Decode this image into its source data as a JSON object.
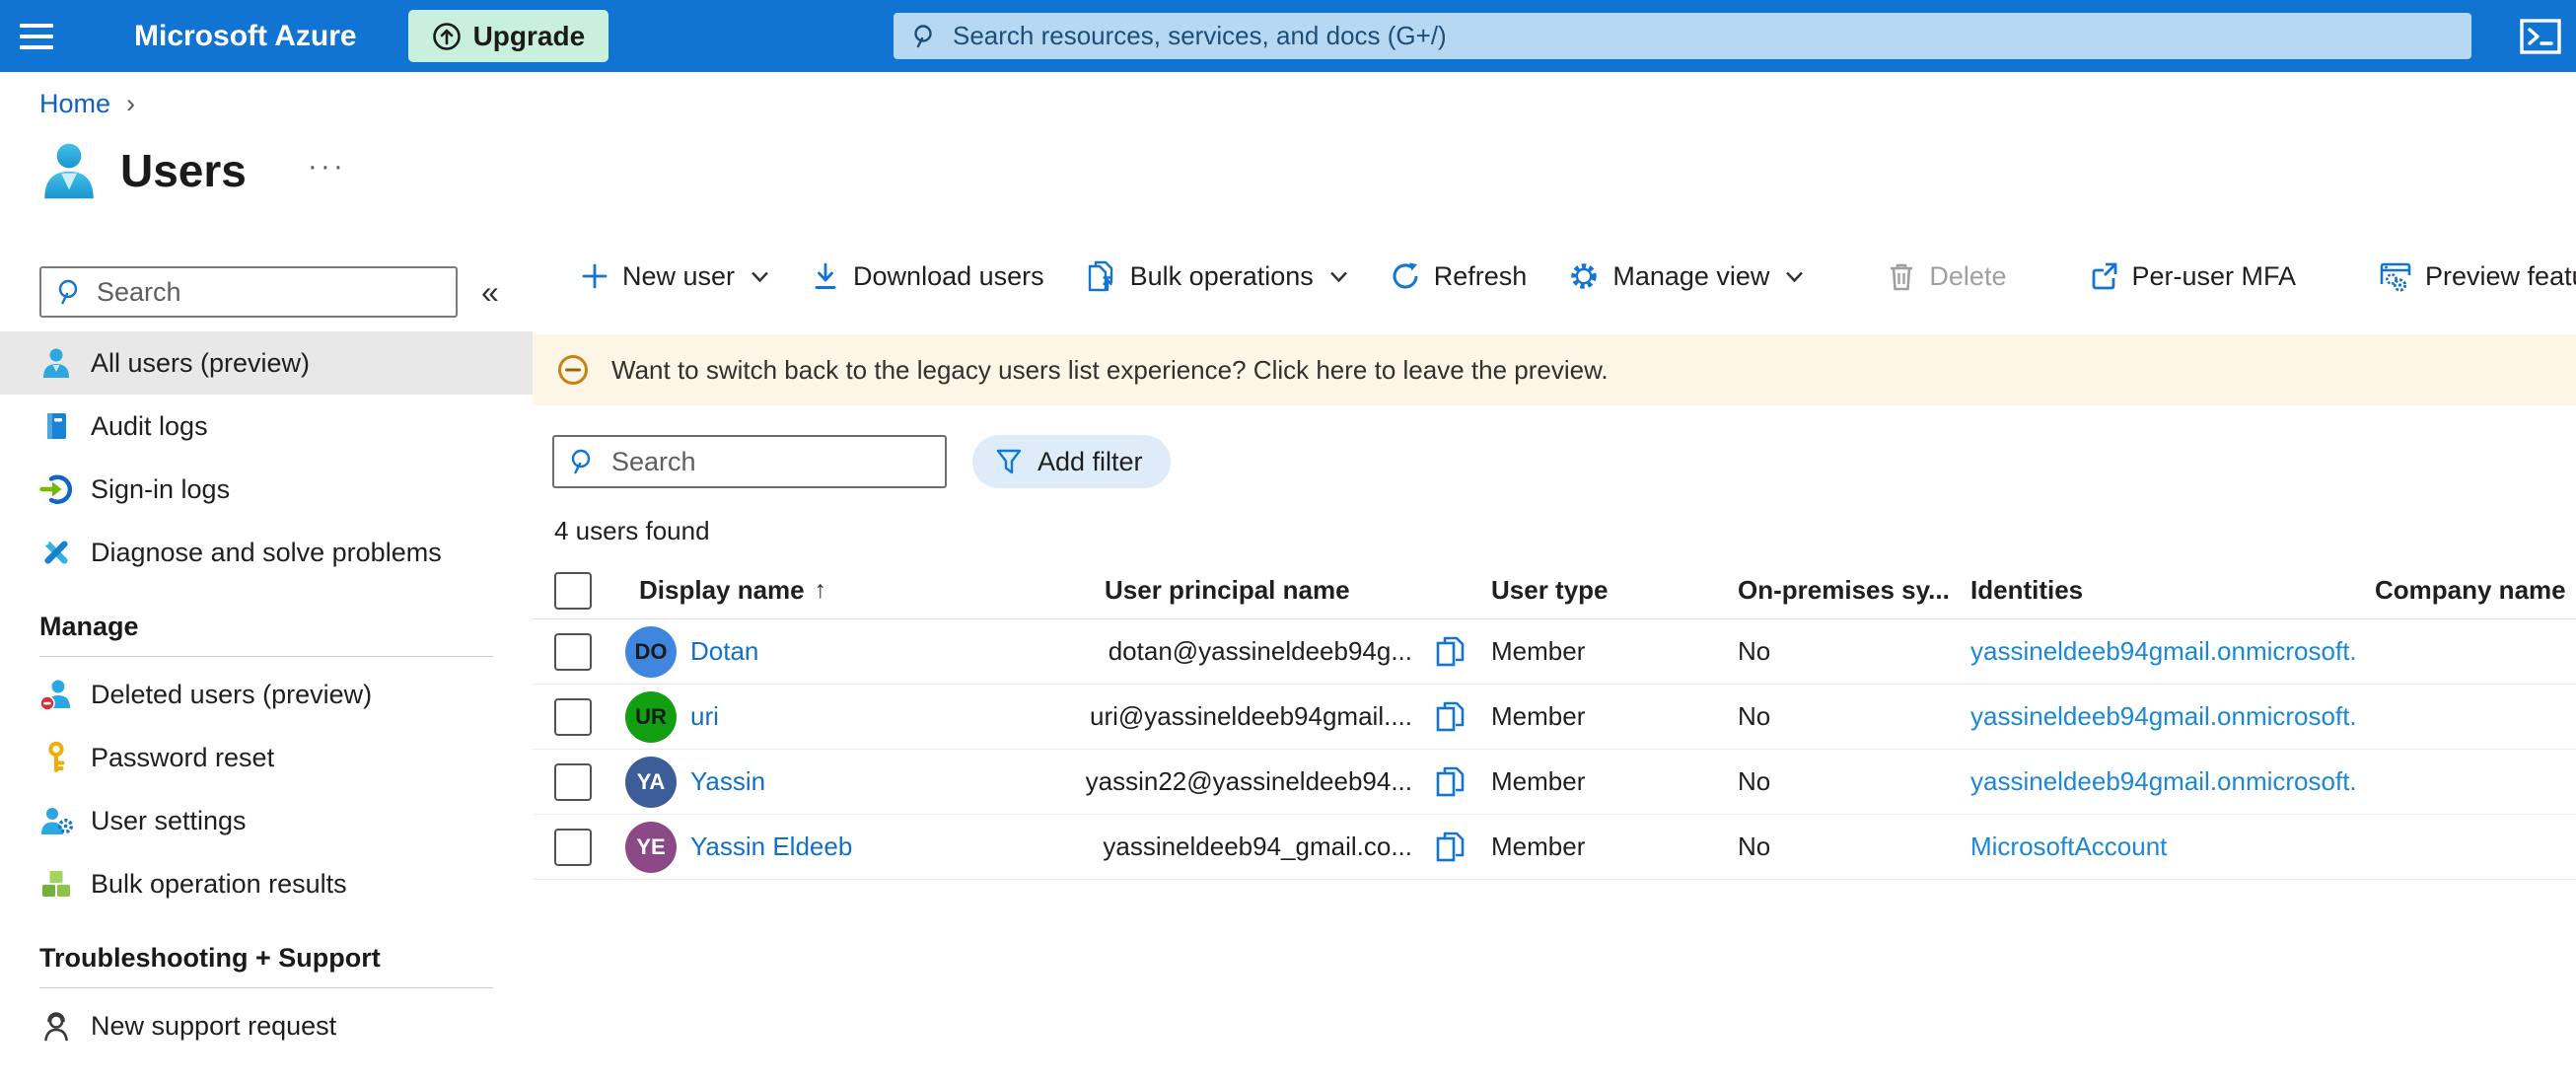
{
  "colors": {
    "topbar_bg": "#1173d2",
    "topsearch_bg": "#b7d8f2",
    "upgrade_bg": "#c9f0dc",
    "accent_blue": "#1374d1",
    "link_blue": "#1170c9",
    "identity_link": "#1b87d6",
    "banner_bg": "#fdf6e7",
    "banner_icon": "#c8820e",
    "selected_item_bg": "#e8e8e8",
    "add_filter_bg": "#deecf9",
    "disabled_gray": "#a19f9d"
  },
  "topbar": {
    "brand": "Microsoft Azure",
    "upgrade_label": "Upgrade",
    "search_placeholder": "Search resources, services, and docs (G+/)"
  },
  "breadcrumb": {
    "home": "Home",
    "separator": "›"
  },
  "page": {
    "title": "Users",
    "more": "···"
  },
  "sidebar": {
    "search_placeholder": "Search",
    "collapse_icon": "«",
    "items": [
      {
        "label": "All users (preview)",
        "selected": true
      },
      {
        "label": "Audit logs"
      },
      {
        "label": "Sign-in logs"
      },
      {
        "label": "Diagnose and solve problems"
      },
      {
        "label": "Deleted users (preview)"
      },
      {
        "label": "Password reset"
      },
      {
        "label": "User settings"
      },
      {
        "label": "Bulk operation results"
      },
      {
        "label": "New support request"
      }
    ],
    "headers": {
      "manage": "Manage",
      "troubleshooting": "Troubleshooting + Support"
    }
  },
  "toolbar": {
    "new_user": "New user",
    "download_users": "Download users",
    "bulk_operations": "Bulk operations",
    "refresh": "Refresh",
    "manage_view": "Manage view",
    "delete": "Delete",
    "per_user_mfa": "Per-user MFA",
    "preview_features": "Preview features"
  },
  "banner": {
    "text": "Want to switch back to the legacy users list experience? Click here to leave the preview."
  },
  "filters": {
    "search_placeholder": "Search",
    "add_filter": "Add filter"
  },
  "results_count": "4 users found",
  "table": {
    "headers": {
      "display_name": "Display name",
      "sort_arrow": "↑",
      "user_principal_name": "User principal name",
      "user_type": "User type",
      "on_premises": "On-premises sy...",
      "identities": "Identities",
      "company_name": "Company name"
    },
    "rows": [
      {
        "initials": "DO",
        "avatar_bg": "#3f87de",
        "avatar_fg": "#1b1b1b",
        "display_name": "Dotan",
        "upn": "dotan@yassineldeeb94g...",
        "user_type": "Member",
        "on_premises": "No",
        "identity": "yassineldeeb94gmail.onmicrosoft.",
        "company": ""
      },
      {
        "initials": "UR",
        "avatar_bg": "#12a012",
        "avatar_fg": "#1b1b1b",
        "display_name": "uri",
        "upn": "uri@yassineldeeb94gmail....",
        "user_type": "Member",
        "on_premises": "No",
        "identity": "yassineldeeb94gmail.onmicrosoft.",
        "company": ""
      },
      {
        "initials": "YA",
        "avatar_bg": "#3c5d97",
        "avatar_fg": "#ffffff",
        "display_name": "Yassin",
        "upn": "yassin22@yassineldeeb94...",
        "user_type": "Member",
        "on_premises": "No",
        "identity": "yassineldeeb94gmail.onmicrosoft.",
        "company": ""
      },
      {
        "initials": "YE",
        "avatar_bg": "#8b4a87",
        "avatar_fg": "#ffffff",
        "display_name": "Yassin Eldeeb",
        "upn": "yassineldeeb94_gmail.co...",
        "user_type": "Member",
        "on_premises": "No",
        "identity": "MicrosoftAccount",
        "company": ""
      }
    ]
  }
}
